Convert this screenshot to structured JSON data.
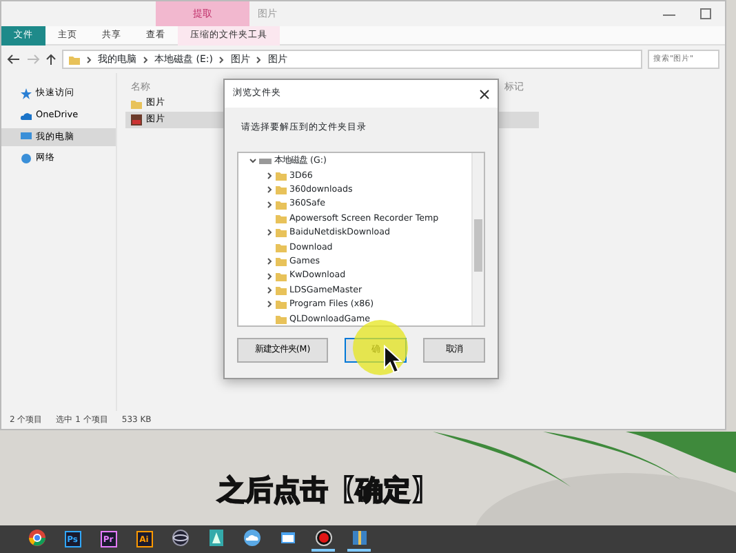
{
  "window": {
    "title": "图片",
    "context_tab": "提取"
  },
  "ribbon_tabs": [
    {
      "label": "文件",
      "kind": "file"
    },
    {
      "label": "主页",
      "kind": "tab"
    },
    {
      "label": "共享",
      "kind": "tab"
    },
    {
      "label": "查看",
      "kind": "tab"
    },
    {
      "label": "压缩的文件夹工具",
      "kind": "tool"
    }
  ],
  "address": {
    "path": [
      "我的电脑",
      "本地磁盘 (E:)",
      "图片",
      "图片"
    ],
    "search_placeholder": "搜索\"图片\""
  },
  "nav": [
    {
      "label": "快速访问",
      "kind": "star",
      "selected": false
    },
    {
      "label": "OneDrive",
      "kind": "cloud",
      "selected": false
    },
    {
      "label": "我的电脑",
      "kind": "pc",
      "selected": true
    },
    {
      "label": "网络",
      "kind": "network",
      "selected": false
    }
  ],
  "file_list": {
    "columns": [
      "名称",
      "标记"
    ],
    "rows": [
      {
        "name": "图片",
        "kind": "folder",
        "selected": false
      },
      {
        "name": "图片",
        "kind": "image",
        "selected": true
      }
    ]
  },
  "status_bar": {
    "count": "2 个项目",
    "selection": "选中 1 个项目",
    "size": "533 KB"
  },
  "dialog": {
    "title": "浏览文件夹",
    "prompt": "请选择要解压到的文件夹目录",
    "tree": {
      "label": "本地磁盘 (G:)",
      "expanded": true,
      "children": [
        {
          "label": "3D66",
          "expandable": true
        },
        {
          "label": "360downloads",
          "expandable": true
        },
        {
          "label": "360Safe",
          "expandable": true
        },
        {
          "label": "Apowersoft Screen Recorder Temp",
          "expandable": false
        },
        {
          "label": "BaiduNetdiskDownload",
          "expandable": true
        },
        {
          "label": "Download",
          "expandable": false
        },
        {
          "label": "Games",
          "expandable": true
        },
        {
          "label": "KwDownload",
          "expandable": true
        },
        {
          "label": "LDSGameMaster",
          "expandable": true
        },
        {
          "label": "Program Files (x86)",
          "expandable": true
        },
        {
          "label": "QLDownloadGame",
          "expandable": false
        }
      ]
    },
    "buttons": [
      {
        "label": "新建文件夹(M)",
        "kind": "normal"
      },
      {
        "label": "确",
        "kind": "default"
      },
      {
        "label": "取消",
        "kind": "normal"
      }
    ]
  },
  "subtitle": "之后点击【确定】",
  "taskbar": [
    {
      "kind": "chrome",
      "active": false
    },
    {
      "kind": "app",
      "label": "Ps",
      "color": "#31a8ff",
      "active": false
    },
    {
      "kind": "app",
      "label": "Pr",
      "color": "#e77cff",
      "active": false
    },
    {
      "kind": "app",
      "label": "Ai",
      "color": "#ff9a00",
      "active": false
    },
    {
      "kind": "sphere",
      "active": false
    },
    {
      "kind": "green",
      "active": false
    },
    {
      "kind": "cloud",
      "active": false
    },
    {
      "kind": "window",
      "active": false
    },
    {
      "kind": "record",
      "active": true
    },
    {
      "kind": "archive",
      "active": true
    }
  ]
}
